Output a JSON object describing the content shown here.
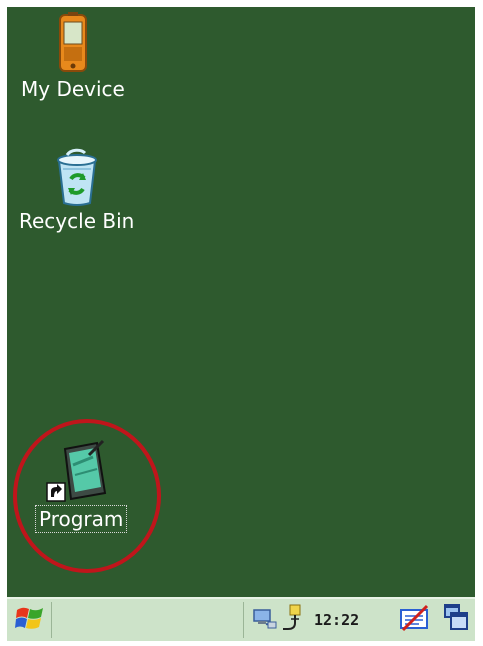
{
  "desktop": {
    "background_color": "#2e5a2e",
    "icons": [
      {
        "name": "my-device",
        "label": "My Device",
        "icon": "pda-device-icon"
      },
      {
        "name": "recycle-bin",
        "label": "Recycle Bin",
        "icon": "recycle-bin-icon"
      },
      {
        "name": "program",
        "label": "Program",
        "icon": "program-shortcut-icon",
        "selected": true,
        "highlighted": true
      }
    ]
  },
  "annotation": {
    "ring_color": "#c0151b"
  },
  "taskbar": {
    "background_color": "#cde3c9",
    "start_icon": "windows-flag-icon",
    "tray": {
      "network_icon": "network-icon",
      "usb_icon": "usb-connection-icon",
      "clock": "12:22",
      "input_panel_icon": "input-panel-icon"
    },
    "switcher_icon": "window-switcher-icon"
  }
}
